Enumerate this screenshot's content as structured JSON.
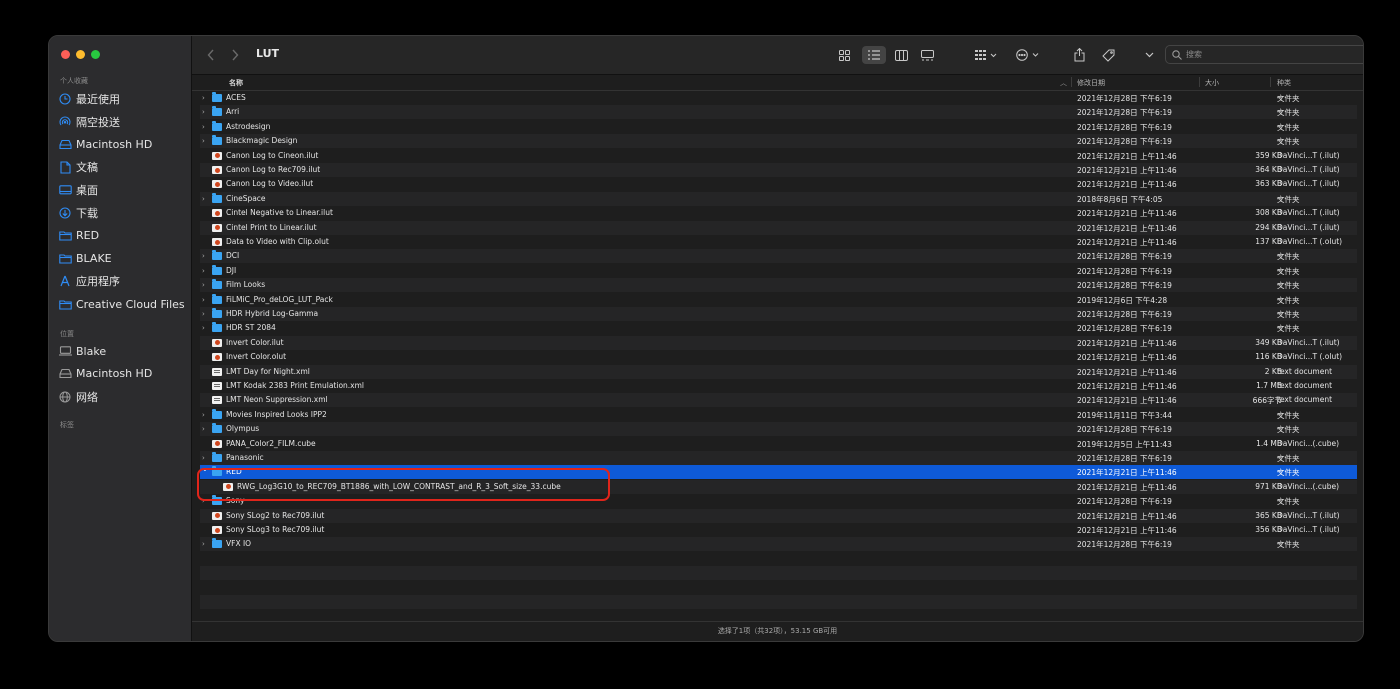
{
  "window": {
    "title": "LUT"
  },
  "colors": {
    "accent": "#0e5ad8",
    "folder": "#3aa4f2",
    "highlight": "#e0251b"
  },
  "sidebar": {
    "favorites_label": "个人收藏",
    "favorites": [
      {
        "label": "最近使用",
        "icon": "clock-icon"
      },
      {
        "label": "隔空投送",
        "icon": "airdrop-icon"
      },
      {
        "label": "Macintosh HD",
        "icon": "disk-icon"
      },
      {
        "label": "文稿",
        "icon": "document-icon"
      },
      {
        "label": "桌面",
        "icon": "desktop-icon"
      },
      {
        "label": "下载",
        "icon": "download-icon"
      },
      {
        "label": "RED",
        "icon": "folder-icon"
      },
      {
        "label": "BLAKE",
        "icon": "folder-icon"
      },
      {
        "label": "应用程序",
        "icon": "applications-icon"
      },
      {
        "label": "Creative Cloud Files",
        "icon": "folder-icon"
      }
    ],
    "locations_label": "位置",
    "locations": [
      {
        "label": "Blake",
        "icon": "computer-icon"
      },
      {
        "label": "Macintosh HD",
        "icon": "disk-icon"
      },
      {
        "label": "网络",
        "icon": "network-icon"
      }
    ],
    "tags_label": "标签"
  },
  "toolbar": {
    "search_placeholder": "搜索",
    "icons": [
      "back-icon",
      "forward-icon",
      "icon-view-icon",
      "list-view-icon",
      "column-view-icon",
      "gallery-view-icon",
      "group-icon",
      "action-icon",
      "share-icon",
      "tag-icon",
      "more-icon",
      "search-icon"
    ]
  },
  "columns": {
    "name": "名称",
    "date": "修改日期",
    "size": "大小",
    "kind": "种类"
  },
  "files": [
    {
      "name": "ACES",
      "type": "folder",
      "date": "2021年12月28日 下午6:19",
      "size": "--",
      "kind": "文件夹"
    },
    {
      "name": "Arri",
      "type": "folder",
      "date": "2021年12月28日 下午6:19",
      "size": "--",
      "kind": "文件夹"
    },
    {
      "name": "Astrodesign",
      "type": "folder",
      "date": "2021年12月28日 下午6:19",
      "size": "--",
      "kind": "文件夹"
    },
    {
      "name": "Blackmagic Design",
      "type": "folder",
      "date": "2021年12月28日 下午6:19",
      "size": "--",
      "kind": "文件夹"
    },
    {
      "name": "Canon Log to Cineon.ilut",
      "type": "lut",
      "date": "2021年12月21日 上午11:46",
      "size": "359 KB",
      "kind": "DaVinci...T (.ilut)"
    },
    {
      "name": "Canon Log to Rec709.ilut",
      "type": "lut",
      "date": "2021年12月21日 上午11:46",
      "size": "364 KB",
      "kind": "DaVinci...T (.ilut)"
    },
    {
      "name": "Canon Log to Video.ilut",
      "type": "lut",
      "date": "2021年12月21日 上午11:46",
      "size": "363 KB",
      "kind": "DaVinci...T (.ilut)"
    },
    {
      "name": "CineSpace",
      "type": "folder",
      "date": "2018年8月6日 下午4:05",
      "size": "--",
      "kind": "文件夹"
    },
    {
      "name": "Cintel Negative to Linear.ilut",
      "type": "lut",
      "date": "2021年12月21日 上午11:46",
      "size": "308 KB",
      "kind": "DaVinci...T (.ilut)"
    },
    {
      "name": "Cintel Print to Linear.ilut",
      "type": "lut",
      "date": "2021年12月21日 上午11:46",
      "size": "294 KB",
      "kind": "DaVinci...T (.ilut)"
    },
    {
      "name": "Data to Video with Clip.olut",
      "type": "lut",
      "date": "2021年12月21日 上午11:46",
      "size": "137 KB",
      "kind": "DaVinci...T (.olut)"
    },
    {
      "name": "DCI",
      "type": "folder",
      "date": "2021年12月28日 下午6:19",
      "size": "--",
      "kind": "文件夹"
    },
    {
      "name": "DJI",
      "type": "folder",
      "date": "2021年12月28日 下午6:19",
      "size": "--",
      "kind": "文件夹"
    },
    {
      "name": "Film Looks",
      "type": "folder",
      "date": "2021年12月28日 下午6:19",
      "size": "--",
      "kind": "文件夹"
    },
    {
      "name": "FiLMiC_Pro_deLOG_LUT_Pack",
      "type": "folder",
      "date": "2019年12月6日 下午4:28",
      "size": "--",
      "kind": "文件夹"
    },
    {
      "name": "HDR Hybrid Log-Gamma",
      "type": "folder",
      "date": "2021年12月28日 下午6:19",
      "size": "--",
      "kind": "文件夹"
    },
    {
      "name": "HDR ST 2084",
      "type": "folder",
      "date": "2021年12月28日 下午6:19",
      "size": "--",
      "kind": "文件夹"
    },
    {
      "name": "Invert Color.ilut",
      "type": "lut",
      "date": "2021年12月21日 上午11:46",
      "size": "349 KB",
      "kind": "DaVinci...T (.ilut)"
    },
    {
      "name": "Invert Color.olut",
      "type": "lut",
      "date": "2021年12月21日 上午11:46",
      "size": "116 KB",
      "kind": "DaVinci...T (.olut)"
    },
    {
      "name": "LMT Day for Night.xml",
      "type": "xml",
      "date": "2021年12月21日 上午11:46",
      "size": "2 KB",
      "kind": "text document"
    },
    {
      "name": "LMT Kodak 2383 Print Emulation.xml",
      "type": "xml",
      "date": "2021年12月21日 上午11:46",
      "size": "1.7 MB",
      "kind": "text document"
    },
    {
      "name": "LMT Neon Suppression.xml",
      "type": "xml",
      "date": "2021年12月21日 上午11:46",
      "size": "666字节",
      "kind": "text document"
    },
    {
      "name": "Movies Inspired Looks IPP2",
      "type": "folder",
      "date": "2019年11月11日 下午3:44",
      "size": "--",
      "kind": "文件夹"
    },
    {
      "name": "Olympus",
      "type": "folder",
      "date": "2021年12月28日 下午6:19",
      "size": "--",
      "kind": "文件夹"
    },
    {
      "name": "PANA_Color2_FILM.cube",
      "type": "lut",
      "date": "2019年12月5日 上午11:43",
      "size": "1.4 MB",
      "kind": "DaVinci...(.cube)"
    },
    {
      "name": "Panasonic",
      "type": "folder",
      "date": "2021年12月28日 下午6:19",
      "size": "--",
      "kind": "文件夹"
    },
    {
      "name": "RED",
      "type": "folder",
      "expanded": true,
      "selected": true,
      "date": "2021年12月21日 上午11:46",
      "size": "--",
      "kind": "文件夹"
    },
    {
      "name": "RWG_Log3G10_to_REC709_BT1886_with_LOW_CONTRAST_and_R_3_Soft_size_33.cube",
      "type": "lut",
      "indent": 1,
      "date": "2021年12月21日 上午11:46",
      "size": "971 KB",
      "kind": "DaVinci...(.cube)"
    },
    {
      "name": "Sony",
      "type": "folder",
      "date": "2021年12月28日 下午6:19",
      "size": "--",
      "kind": "文件夹"
    },
    {
      "name": "Sony SLog2 to Rec709.ilut",
      "type": "lut",
      "date": "2021年12月21日 上午11:46",
      "size": "365 KB",
      "kind": "DaVinci...T (.ilut)"
    },
    {
      "name": "Sony SLog3 to Rec709.ilut",
      "type": "lut",
      "date": "2021年12月21日 上午11:46",
      "size": "356 KB",
      "kind": "DaVinci...T (.ilut)"
    },
    {
      "name": "VFX IO",
      "type": "folder",
      "date": "2021年12月28日 下午6:19",
      "size": "--",
      "kind": "文件夹"
    }
  ],
  "status": {
    "text": "选择了1项（共32项），53.15 GB可用"
  }
}
